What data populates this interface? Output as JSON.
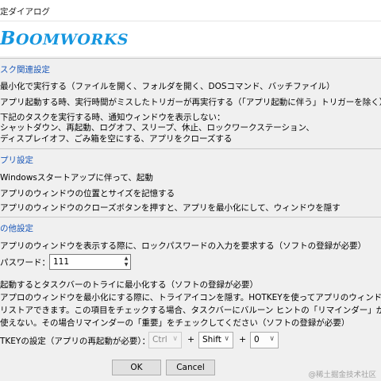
{
  "window": {
    "title": "定ダイアログ"
  },
  "logo": {
    "first": "B",
    "rest": "OOMWORKS"
  },
  "section1": {
    "title": "スク関連設定",
    "items": [
      "最小化で実行する（ファイルを開く、フォルダを開く、DOSコマンド、バッチファイル）",
      "アプリ起動する時、実行時間がミスしたトリガーが再実行する（「アプリ起動に伴う」トリガーを除く）",
      "下記のタスクを実行する時、通知ウィンドウを表示しない："
    ],
    "note_lines": [
      "シャットダウン、再起動、ログオフ、スリープ、休止、ロックワークステーション、",
      "ディスプレイオフ、ごみ箱を空にする、アプリをクローズする"
    ]
  },
  "section2": {
    "title": "プリ設定",
    "items": [
      "Windowsスタートアップに伴って、起動",
      "アプリのウィンドウの位置とサイズを記憶する",
      "アプリのウィンドウのクローズボタンを押すと、アプリを最小化にして、ウィンドウを隠す"
    ]
  },
  "section3": {
    "title": "の他設定",
    "lock_item": "アプリのウィンドウを表示する際に、ロックパスワードの入力を要求する（ソフトの登録が必要）",
    "password_label": "パスワード：",
    "password_value": "111",
    "tray_item": "起動するとタスクバーのトライに最小化する（ソフトの登録が必要）",
    "tray_note_lines": [
      "アプロのウィンドウを最小化にする際に、トライアイコンを隠す。HOTKEYを使ってアプリのウィンドウが",
      "リストアできます。この項目をチェックする場合、タスクバーにバルーン ヒントの「リマインダー」が",
      "使えない。その場合リマインダーの「重要」をチェックしてください（ソフトの登録が必要）"
    ],
    "hotkey_label": "TKEYの設定（アプリの再起動が必要）：",
    "hotkey": {
      "modifier1": "Ctrl",
      "modifier2": "Shift",
      "key": "0",
      "plus": "+"
    }
  },
  "buttons": {
    "ok": "OK",
    "cancel": "Cancel"
  },
  "watermark": "@稀土掘金技术社区"
}
